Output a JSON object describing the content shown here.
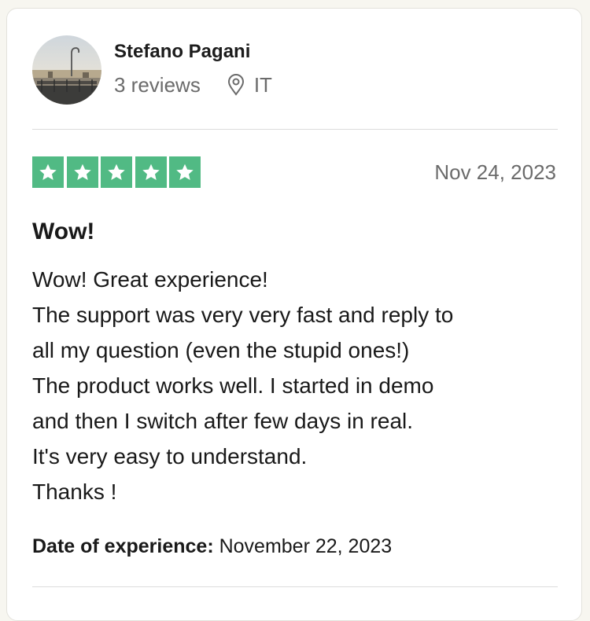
{
  "reviewer": {
    "name": "Stefano Pagani",
    "reviews_count": "3 reviews",
    "country": "IT",
    "avatar_icon": "profile-photo"
  },
  "review": {
    "rating": 5,
    "max_rating": 5,
    "star_color": "#51ba84",
    "date": "Nov 24, 2023",
    "title": "Wow!",
    "body": "Wow! Great experience!\nThe support was very very fast and reply to\nall my question (even the stupid ones!)\nThe product works well. I started in demo\nand then I switch after few days in real.\nIt's very easy to understand.\nThanks !",
    "experience_label": "Date of experience:",
    "experience_date": "November 22, 2023"
  }
}
